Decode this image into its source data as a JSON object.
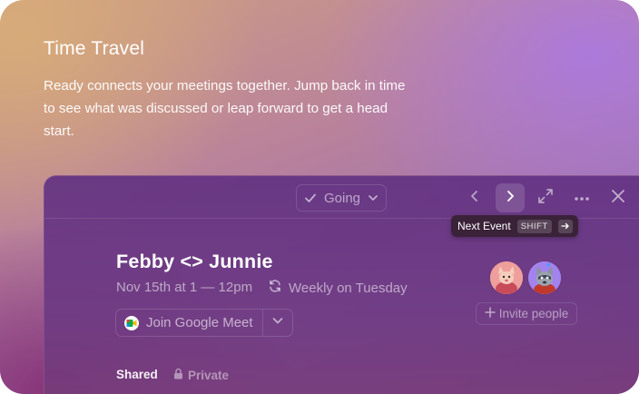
{
  "intro": {
    "title": "Time Travel",
    "description": "Ready connects your meetings together. Jump back in time to see what was discussed or leap forward to get a head start."
  },
  "toolbar": {
    "rsvp_label": "Going",
    "icons": [
      "check-icon",
      "chevron-down-icon",
      "chevron-left-icon",
      "chevron-right-icon",
      "expand-icon",
      "more-icon",
      "close-icon"
    ],
    "tooltip": {
      "label": "Next Event",
      "key": "SHIFT",
      "arrow_icon": "arrow-right-icon"
    }
  },
  "event": {
    "title": "Febby <> Junnie",
    "time": "Nov 15th at 1 — 12pm",
    "recurrence": "Weekly on Tuesday",
    "meeting_button": "Join Google Meet"
  },
  "attendees": {
    "invite_label": "Invite people",
    "count": 2
  },
  "visibility": {
    "shared_label": "Shared",
    "private_label": "Private"
  },
  "colors": {
    "panel": "#6e3a82",
    "tooltip_bg": "#3a2238",
    "text": "#ffffff"
  }
}
